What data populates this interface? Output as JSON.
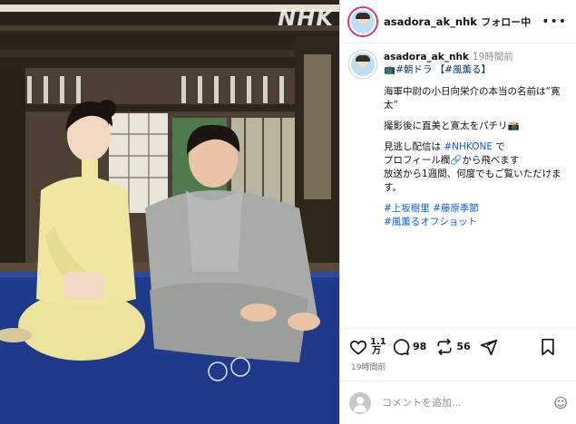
{
  "photo": {
    "watermark": "NHK",
    "description_icon": "photo"
  },
  "header": {
    "username": "asadora_ak_nhk",
    "follow_label": "フォロー中",
    "more_icon": "more-horizontal-icon"
  },
  "caption": {
    "username": "asadora_ak_nhk",
    "time": "19時間前",
    "first_line": "📺#朝ドラ 【#風薫る】",
    "line1": "海軍中尉の小日向栄介の本当の名前は“寛太”",
    "line2": "撮影後に直美と寛太をパチリ📸",
    "line3a": "見逃し配信は ",
    "line3_tag": "#NHKONE",
    "line3b": " で",
    "line4": "プロフィール欄🔗から飛べます",
    "line5": "放送から1週間、何度でもご覧いただけます。",
    "tags1": "#上坂樹里 #藤原季節",
    "tags2": "#風薫るオフショット"
  },
  "actions": {
    "likes_top": "1.1",
    "likes_bottom": "万",
    "comments": "98",
    "reposts": "56",
    "post_time": "19時間前"
  },
  "comment": {
    "placeholder": "コメントを追加...",
    "emoji_icon": "☺"
  },
  "colors": {
    "link": "#00376b",
    "hashtag": "#0b5ed7",
    "muted": "#8e8e8e"
  }
}
